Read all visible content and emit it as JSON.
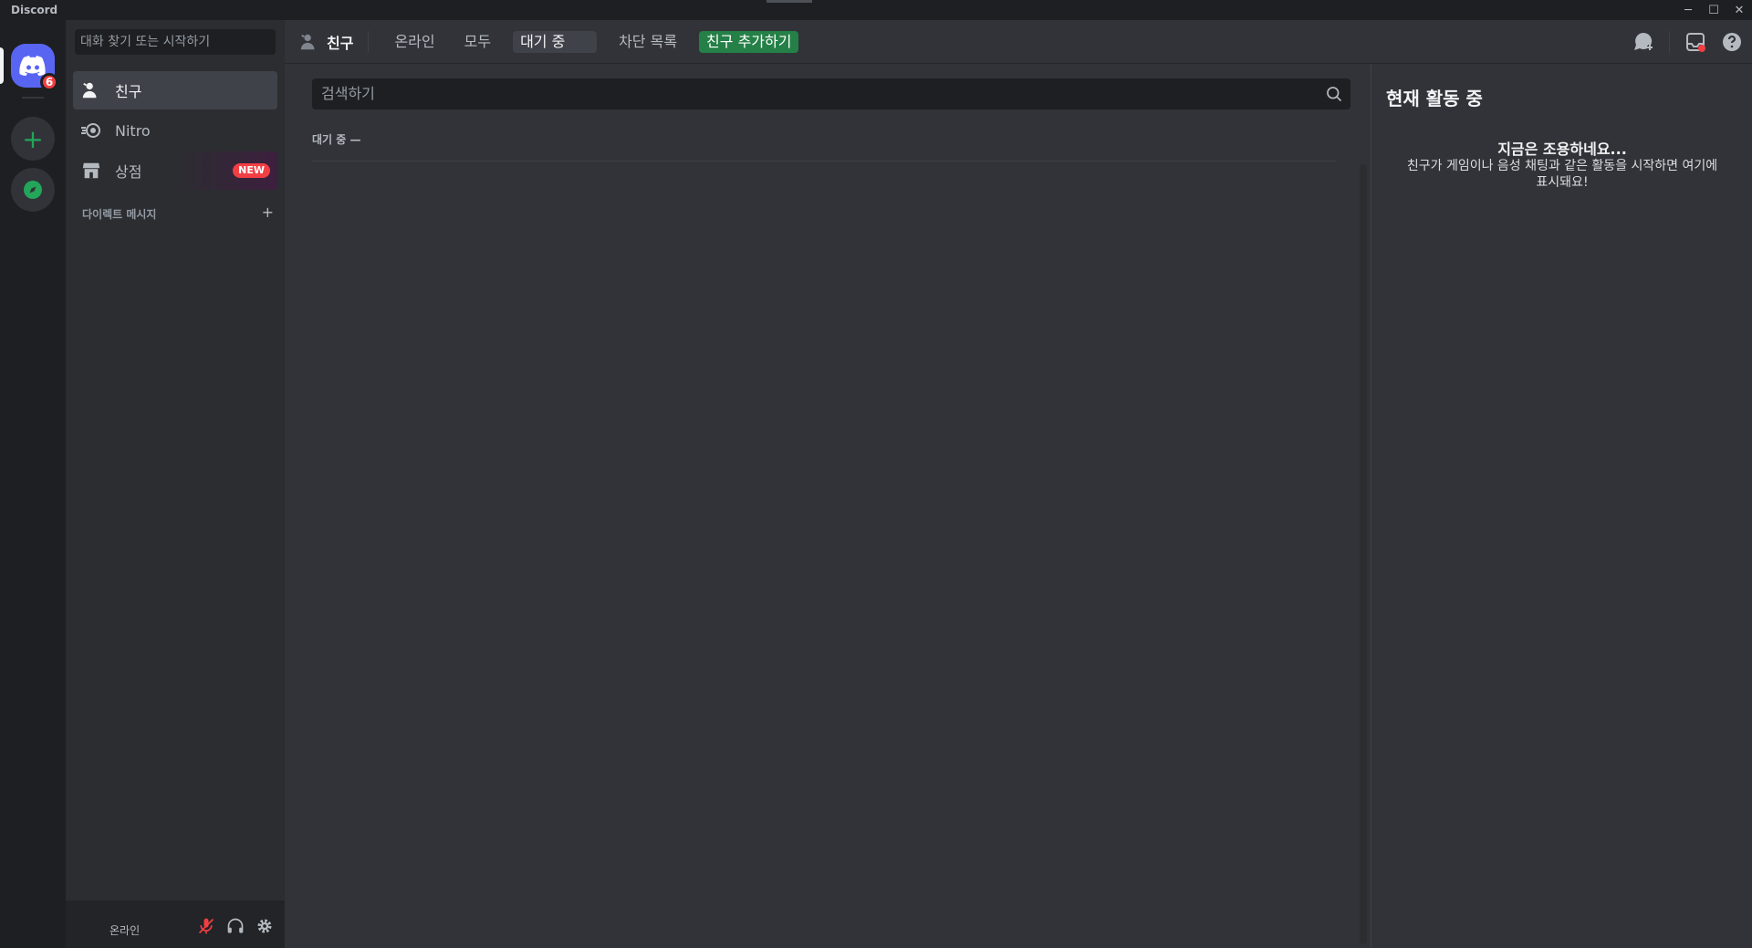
{
  "window": {
    "title": "Discord"
  },
  "server_rail": {
    "home_badge": "6"
  },
  "dm_sidebar": {
    "search_placeholder": "대화 찾기 또는 시작하기",
    "nav": [
      {
        "label": "친구"
      },
      {
        "label": "Nitro"
      },
      {
        "label": "상점",
        "badge": "NEW"
      }
    ],
    "dm_header": "다이렉트 메시지",
    "dm_add": "+"
  },
  "user_panel": {
    "status": "온라인"
  },
  "topbar": {
    "title": "친구",
    "tabs": [
      "온라인",
      "모두",
      "대기 중",
      "차단 목록"
    ],
    "add_friend": "친구 추가하기"
  },
  "main": {
    "search_placeholder": "검색하기",
    "section_label": "대기 중 —"
  },
  "active_now": {
    "title": "현재 활동 중",
    "empty_title": "지금은 조용하네요...",
    "empty_desc": "친구가 게임이나 음성 채팅과 같은 활동을 시작하면 여기에 표시돼요!"
  },
  "colors": {
    "accent": "#5865f2",
    "green": "#248046",
    "red": "#f23f43",
    "bg": "#313338"
  }
}
